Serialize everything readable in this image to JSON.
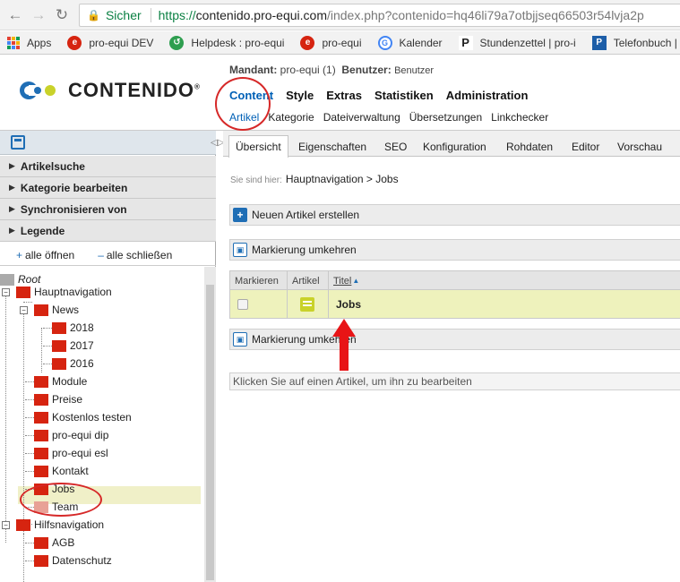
{
  "browser": {
    "secure_label": "Sicher",
    "url_scheme": "https://",
    "url_host": "contenido.pro-equi.com",
    "url_path": "/index.php?contenido=hq46li79a7otbjjseq66503r54lvja2p",
    "bookmarks": [
      {
        "label": "Apps",
        "icon": "apps-grid-icon"
      },
      {
        "label": "pro-equi DEV",
        "icon": "pro-equi-icon",
        "color": "#d62410"
      },
      {
        "label": "Helpdesk : pro-equi",
        "icon": "helpdesk-icon",
        "color": "#2e9e4f"
      },
      {
        "label": "pro-equi",
        "icon": "pro-equi-icon",
        "color": "#d62410"
      },
      {
        "label": "Kalender",
        "icon": "google-icon",
        "color": "#4285f4"
      },
      {
        "label": "Stundenzettel | pro-i",
        "icon": "p-icon",
        "color": "#222222"
      },
      {
        "label": "Telefonbuch |",
        "icon": "p-icon",
        "color": "#1d5ea8"
      }
    ]
  },
  "header": {
    "client_label": "Mandant:",
    "client_value": "pro-equi (1)",
    "user_label": "Benutzer:",
    "user_value": "Benutzer",
    "logo_text": "CONTENIDO",
    "logo_reg": "®",
    "main_nav": [
      "Content",
      "Style",
      "Extras",
      "Statistiken",
      "Administration"
    ],
    "sub_nav": [
      "Artikel",
      "Kategorie",
      "Dateiverwaltung",
      "Übersetzungen",
      "Linkchecker"
    ]
  },
  "left": {
    "accordions": [
      "Artikelsuche",
      "Kategorie bearbeiten",
      "Synchronisieren von",
      "Legende"
    ],
    "expand_all": "alle öffnen",
    "collapse_all": "alle schließen",
    "tree": {
      "root": "Root",
      "hauptnavigation": "Hauptnavigation",
      "news": "News",
      "y2018": "2018",
      "y2017": "2017",
      "y2016": "2016",
      "module": "Module",
      "preise": "Preise",
      "kostenlos": "Kostenlos testen",
      "dip": "pro-equi dip",
      "esl": "pro-equi esl",
      "kontakt": "Kontakt",
      "jobs": "Jobs",
      "team": "Team",
      "hilfsnavigation": "Hilfsnavigation",
      "agb": "AGB",
      "datenschutz": "Datenschutz"
    }
  },
  "right": {
    "tabs": [
      "Übersicht",
      "Eigenschaften",
      "SEO",
      "Konfiguration",
      "Rohdaten",
      "Editor",
      "Vorschau"
    ],
    "breadcrumb_label": "Sie sind hier:",
    "breadcrumb_path": "Hauptnavigation > Jobs",
    "new_article": "Neuen Artikel erstellen",
    "invert_marking": "Markierung umkehren",
    "table": {
      "headers": [
        "Markieren",
        "Artikel",
        "Titel"
      ],
      "rows": [
        {
          "title": "Jobs"
        }
      ]
    },
    "hint": "Klicken Sie auf einen Artikel, um ihn zu bearbeiten"
  },
  "colors": {
    "accent": "#0060b6",
    "folder": "#d62410",
    "annotation": "#d62828",
    "row_highlight": "#eef2bc"
  }
}
